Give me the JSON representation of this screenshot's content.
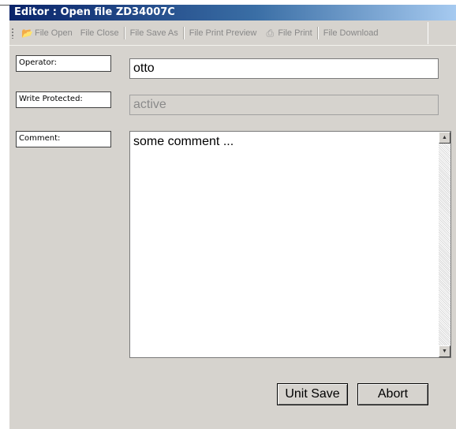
{
  "window": {
    "title": "Editor : Open file ZD34007C"
  },
  "toolbar": {
    "items": [
      {
        "label": "File Open",
        "icon": "folder-open-icon"
      },
      {
        "label": "File Close"
      },
      {
        "label": "File Save As"
      },
      {
        "label": "File Print Preview"
      },
      {
        "label": "File Print",
        "icon": "printer-icon"
      },
      {
        "label": "File Download"
      }
    ]
  },
  "form": {
    "operator": {
      "label": "Operator:",
      "value": "otto"
    },
    "write_protected": {
      "label": "Write Protected:",
      "value": "active"
    },
    "comment": {
      "label": "Comment:",
      "value": "some comment ..."
    }
  },
  "buttons": {
    "unit_save": "Unit Save",
    "abort": "Abort"
  },
  "colors": {
    "window_bg": "#d6d3ce",
    "title_start": "#0a246a",
    "title_end": "#a6caf0"
  }
}
